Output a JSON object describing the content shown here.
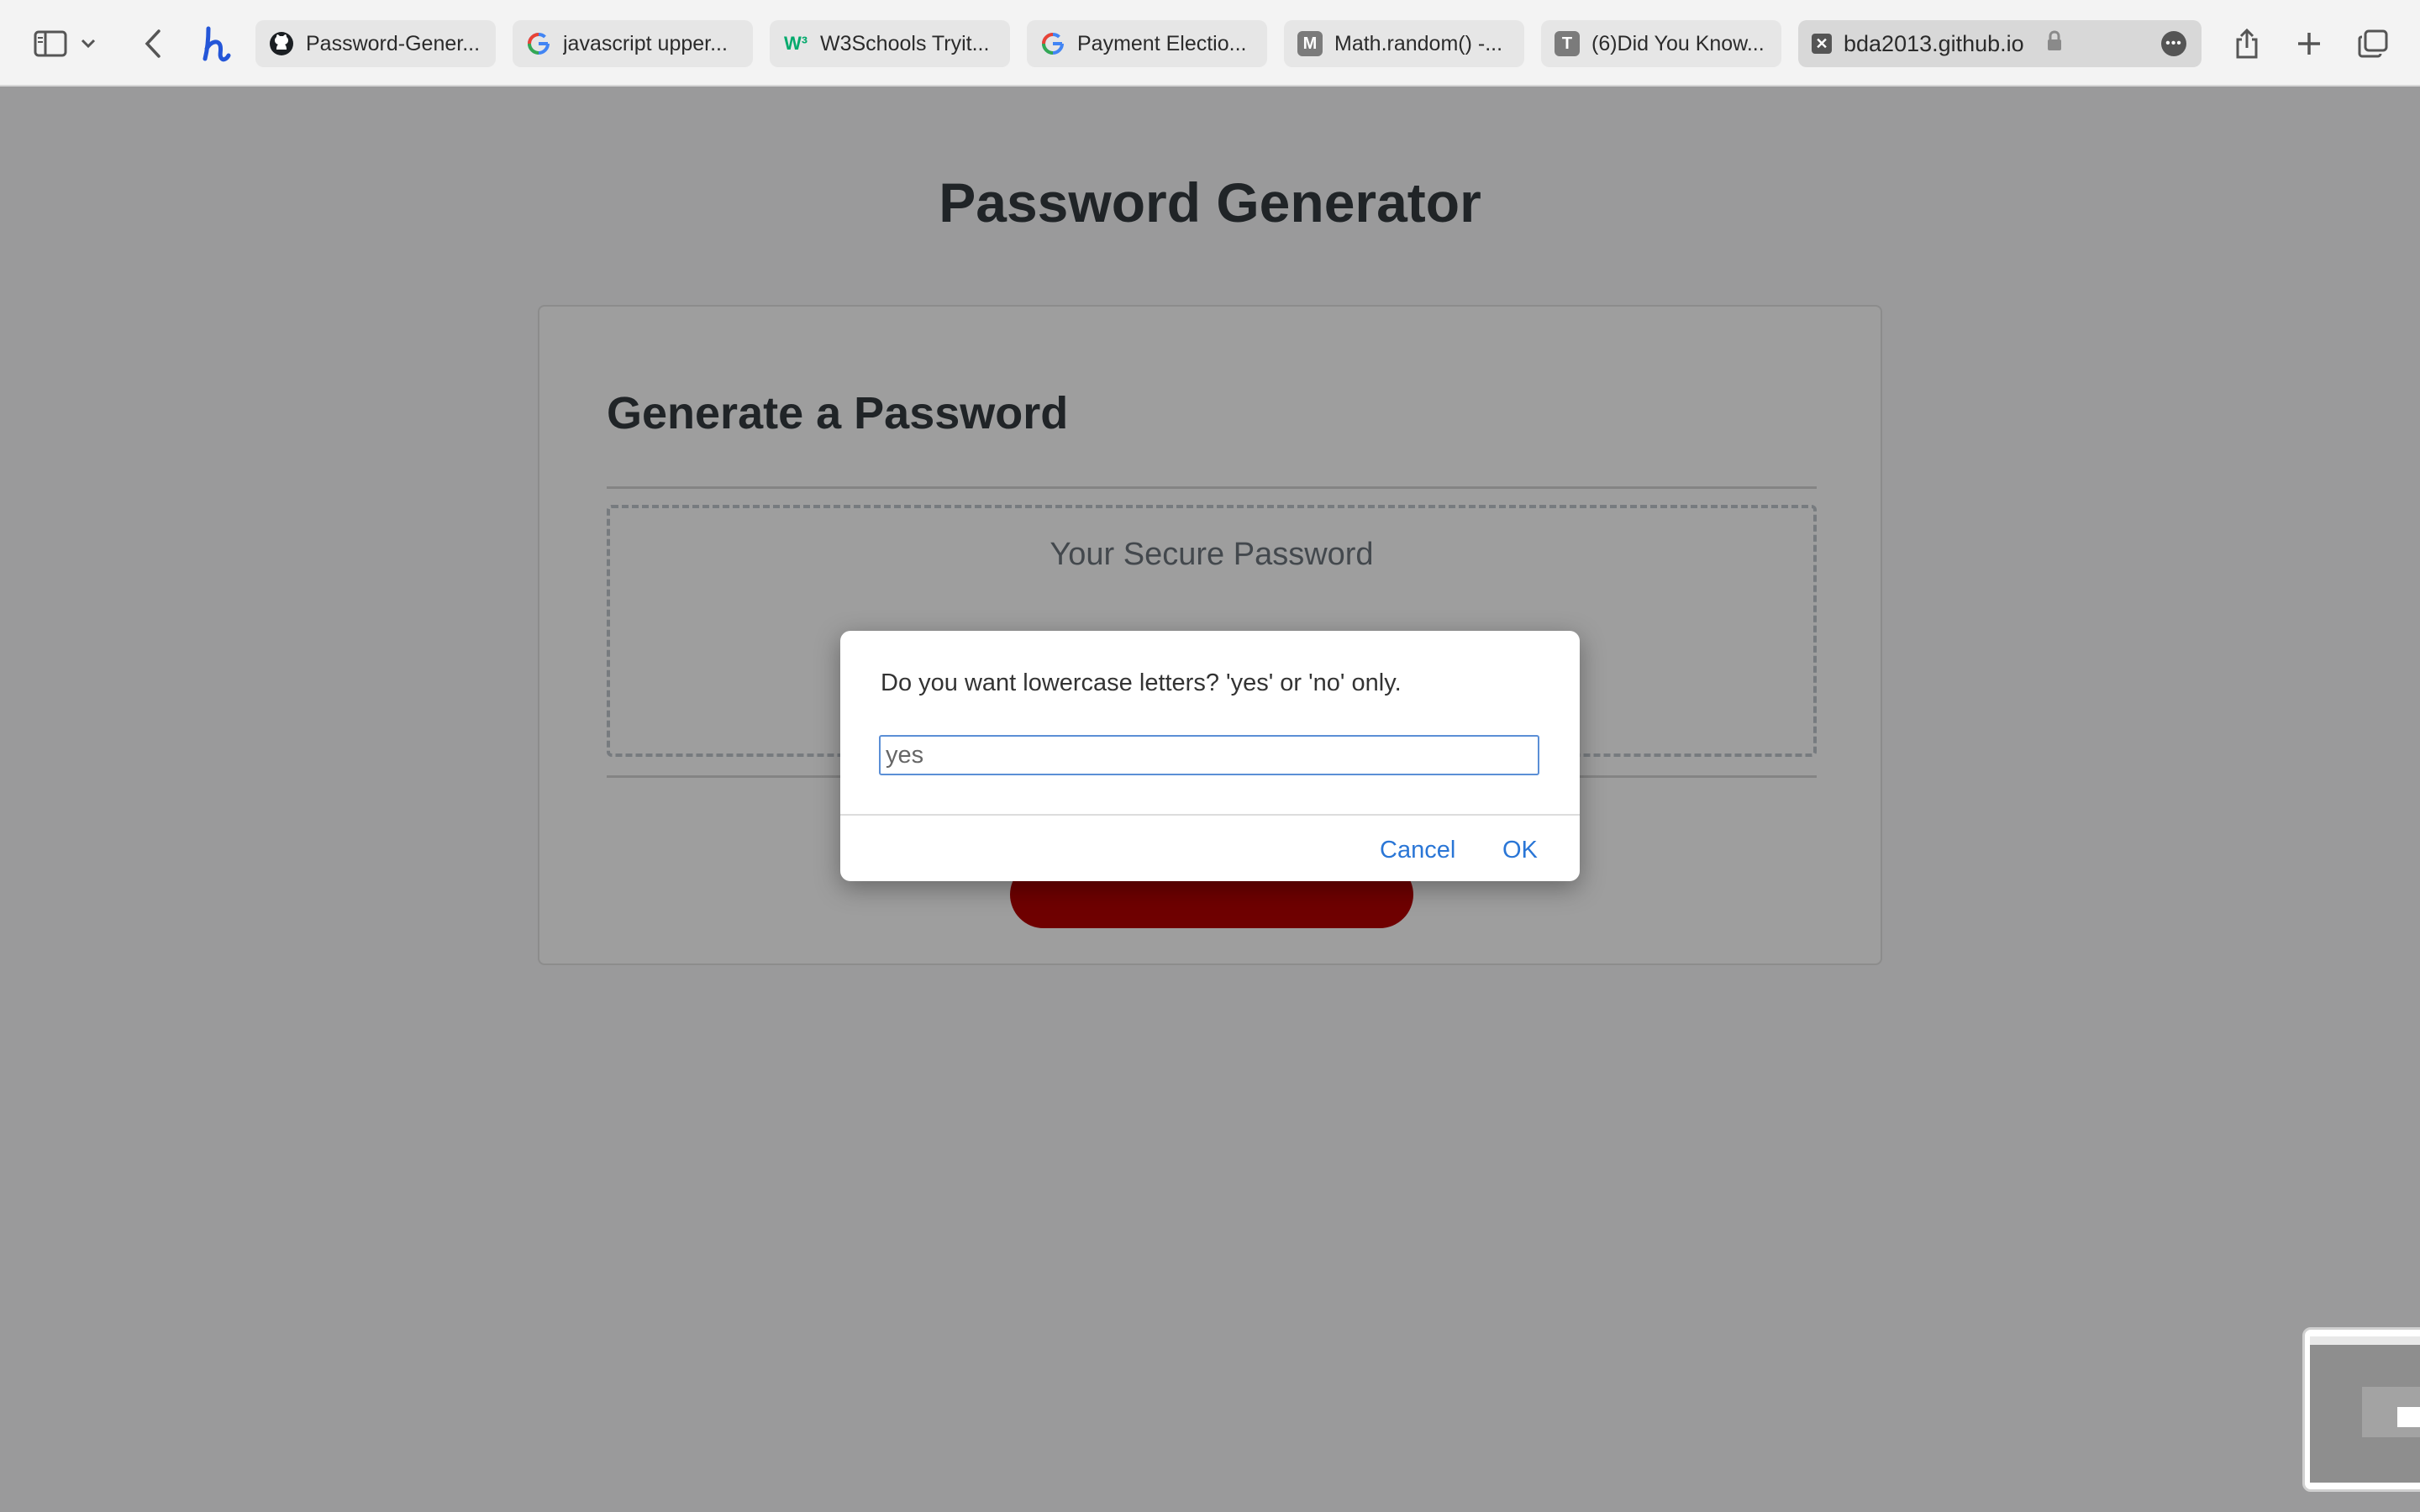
{
  "browser": {
    "tabs": [
      {
        "title": "Password-Gener...",
        "icon": "github-icon"
      },
      {
        "title": "javascript upper...",
        "icon": "google-icon"
      },
      {
        "title": "W3Schools Tryit...",
        "icon": "w3schools-icon"
      },
      {
        "title": "Payment Electio...",
        "icon": "google-icon"
      },
      {
        "title": "Math.random() -...",
        "icon": "m-icon"
      },
      {
        "title": "(6)Did You Know...",
        "icon": "t-icon"
      }
    ],
    "active_tab": {
      "title": "bda2013.github.io",
      "icon": "close-icon"
    }
  },
  "page": {
    "title": "Password Generator",
    "card_header": "Generate a Password",
    "password_placeholder": "Your Secure Password"
  },
  "dialog": {
    "message": "Do you want lowercase letters? 'yes' or 'no' only.",
    "input_value": "yes",
    "cancel_label": "Cancel",
    "ok_label": "OK"
  },
  "colors": {
    "accent_blue": "#2a76d6",
    "generate_button": "#b30000"
  }
}
